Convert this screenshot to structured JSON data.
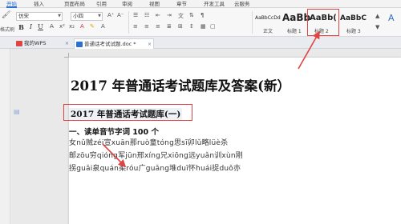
{
  "ribbon_tabs": [
    "开始",
    "插入",
    "页面布局",
    "引用",
    "审阅",
    "视图",
    "章节",
    "开发工具",
    "云服务"
  ],
  "active_tab": "开始",
  "ribbon": {
    "format_painter_label": "格式刷",
    "font_name": "仿宋",
    "font_size": "小四",
    "bold": "B",
    "italic": "I",
    "underline": "U",
    "styles": [
      {
        "sample": "AaBbCcDd",
        "label": "正文"
      },
      {
        "sample": "AaBb",
        "label": "标题 1"
      },
      {
        "sample": "AaBb(",
        "label": "标题 2"
      },
      {
        "sample": "AaBbC",
        "label": "标题 3"
      }
    ]
  },
  "file_tabs": [
    {
      "label": "我的WPS",
      "close": "×"
    },
    {
      "label": "普通话考试试题.doc *",
      "close": "×"
    }
  ],
  "document": {
    "title": "2017 年普通话考试题库及答案(新）",
    "heading": "2017 年普通话考试题库(一)",
    "section": "一、读单音节字词 100 个",
    "lines": [
      "女nǔ贼zéi宣xuān那ruò童tóng思sī卯lǔ略lüè杀",
      "邮zōu穷qióng军jūn邢xíng兄xiōng远yuǎn训xùn刚",
      "拐guǎi泉quán柔róu广guǎng堆duī怀huái捉duǒ亦"
    ]
  },
  "colors": {
    "accent": "#2b6fd6",
    "annotation_red": "#e04343"
  }
}
